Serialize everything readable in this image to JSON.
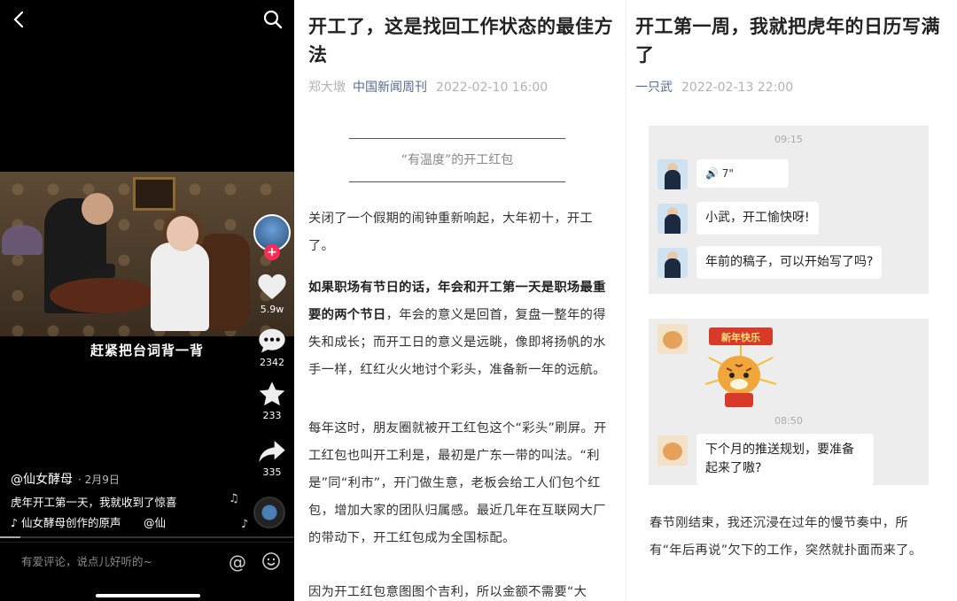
{
  "video": {
    "caption": "赶紧把台词背一背",
    "author": "@仙女酵母",
    "date": "· 2月9日",
    "description": "虎年开工第一天，我就收到了惊喜",
    "music_prefix": "♪",
    "music": "仙女酵母创作的原声",
    "music_tail": "@仙",
    "likes": "5.9w",
    "comments": "2342",
    "favorites": "233",
    "shares": "335",
    "follow_symbol": "+",
    "comment_placeholder": "有爱评论，说点儿好听的~",
    "progress": 0.07
  },
  "article1": {
    "title": "开工了，这是找回工作状态的最佳方法",
    "author": "郑大墩",
    "source": "中国新闻周刊",
    "datetime": "2022-02-10 16:00",
    "section": "“有温度”的开工红包",
    "p1": "关闭了一个假期的闹钟重新响起，大年初十，开工了。",
    "p2_bold": "如果职场有节日的话，年会和开工第一天是职场最重要的两个节日",
    "p2_rest": "，年会的意义是回首，复盘一整年的得失和成长；而开工日的意义是远眺，像即将扬帆的水手一样，红红火火地讨个彩头，准备新一年的远航。",
    "p3": "每年这时，朋友圈就被开工红包这个“彩头”刷屏。开工红包也叫开工利是，最初是广东一带的叫法。“利是”同“利市”，开门做生意，老板会给工人们包个红包，增加大家的团队归属感。最近几年在互联网大厂的带动下，开工红包成为全国标配。",
    "p4": "因为开工红包意图图个吉利，所以金额不需要“大"
  },
  "article2": {
    "title": "开工第一周，我就把虎年的日历写满了",
    "author": "一只武",
    "datetime": "2022-02-13 22:00",
    "chat1": {
      "time": "09:15",
      "voice": "🔊 7\"",
      "msg1": "小武，开工愉快呀!",
      "msg2": "年前的稿子，可以开始写了吗?"
    },
    "chat2": {
      "sticker_text": "新年快乐",
      "time": "08:50",
      "msg": "下个月的推送规划，要准备起来了嗷?"
    },
    "p1": "春节刚结束，我还沉浸在过年的慢节奏中，所有“年后再说”欠下的工作，突然就扑面而来了。"
  }
}
